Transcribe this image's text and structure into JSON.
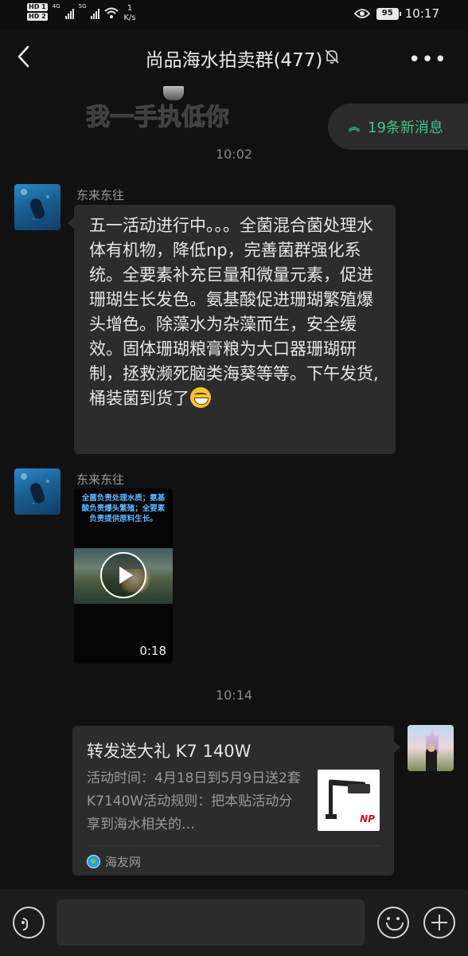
{
  "status_bar": {
    "sim1": "HD 1",
    "sim2": "HD 2",
    "net1": "4G",
    "net2": "5G",
    "speed_value": "1",
    "speed_unit": "K/s",
    "battery": "95",
    "time": "10:17",
    "icons": [
      "signal-icon",
      "wifi-icon",
      "eye-icon",
      "battery-icon"
    ]
  },
  "header": {
    "title": "尚品海水拍卖群(477)",
    "icons": [
      "back-arrow-icon",
      "mute-bell-icon",
      "more-icon"
    ]
  },
  "sticker": {
    "text": "我一手执低你"
  },
  "new_messages": {
    "label": "19条新消息",
    "color": "#43c28a"
  },
  "messages": [
    {
      "type": "time",
      "text": "10:02"
    },
    {
      "type": "text",
      "sender": "东来东往",
      "text": "五一活动进行中。。。全菌混合菌处理水体有机物，降低np，完善菌群强化系统。全要素补充巨量和微量元素，促进珊瑚生长发色。氨基酸促进珊瑚繁殖爆头增色。除藻水为杂藻而生，安全缓效。固体珊瑚粮膏粮为大口器珊瑚研制，拯救濒死脑类海葵等等。下午发货,桶装菌到货了",
      "emoji": "grinning-face"
    },
    {
      "type": "video",
      "sender": "东来东往",
      "caption": "全菌负责处理水质；氨基酸负责爆头繁殖；全要素负责提供原料生长。",
      "duration": "0:18"
    },
    {
      "type": "time",
      "text": "10:14"
    },
    {
      "type": "link_card",
      "title": "转发送大礼 K7 140W",
      "description": "活动时间：4月18日到5月9日送2套K7140W活动规则：把本贴活动分享到海水相关的…",
      "thumb_logo": "NP",
      "source": "海友网"
    }
  ],
  "input_bar": {
    "icons": [
      "voice-icon",
      "emoji-icon",
      "plus-icon"
    ],
    "placeholder": ""
  }
}
